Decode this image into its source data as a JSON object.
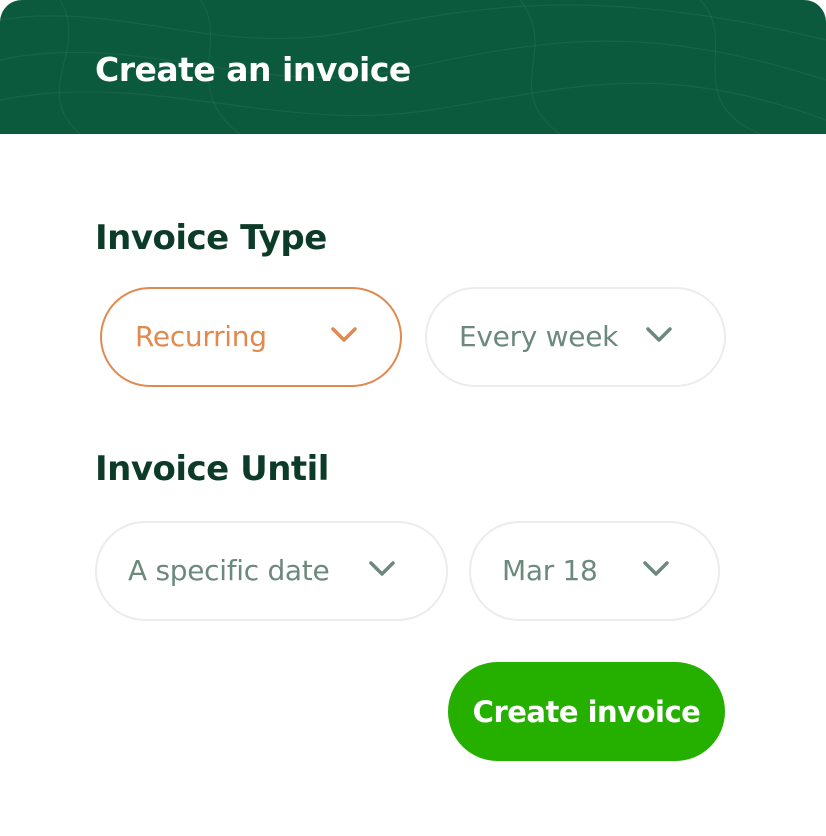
{
  "header": {
    "title": "Create an invoice"
  },
  "invoice_type": {
    "label": "Invoice Type",
    "type_value": "Recurring",
    "frequency_value": "Every week"
  },
  "invoice_until": {
    "label": "Invoice Until",
    "until_value": "A specific date",
    "date_value": "Mar 18"
  },
  "actions": {
    "create_label": "Create invoice"
  },
  "colors": {
    "header_bg": "#0b5a3d",
    "heading_text": "#0d3b29",
    "active_accent": "#e08a4f",
    "muted_text": "#6b8a7d",
    "primary_button": "#25b000"
  },
  "icons": {
    "dropdown_indicator": "chevron-down-icon"
  }
}
